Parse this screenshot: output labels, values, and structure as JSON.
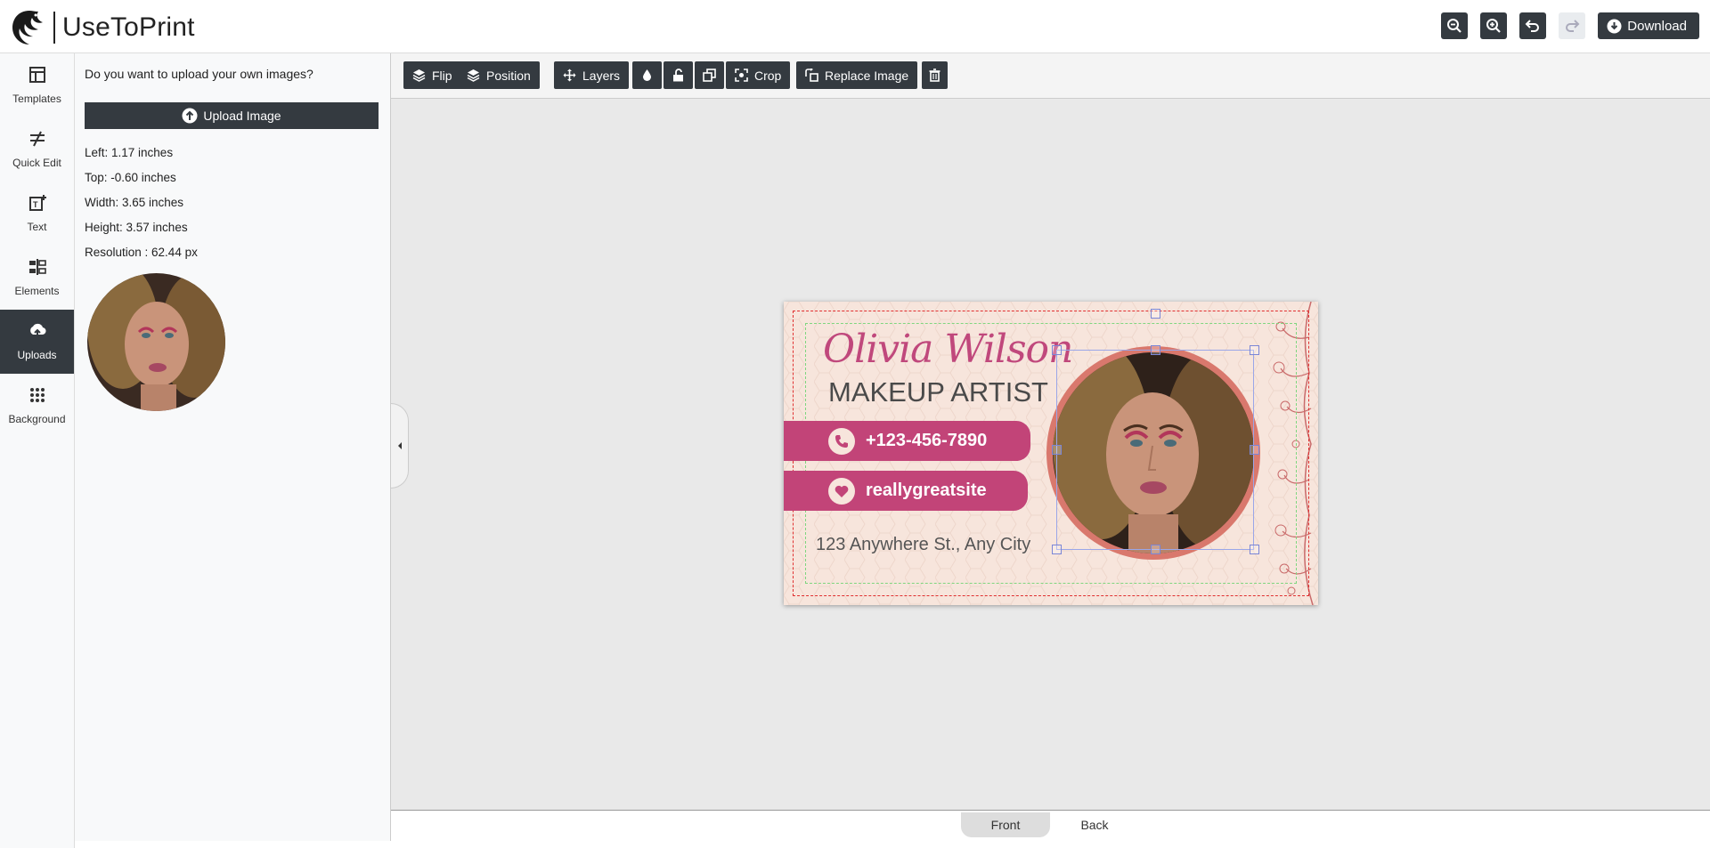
{
  "app": {
    "name": "UseToPrint"
  },
  "header": {
    "zoom_out_icon": "zoom-out-icon",
    "zoom_in_icon": "zoom-in-icon",
    "undo_icon": "undo-icon",
    "redo_icon": "redo-icon",
    "download_label": "Download"
  },
  "sidebar": {
    "items": [
      {
        "label": "Templates",
        "icon": "templates-icon"
      },
      {
        "label": "Quick Edit",
        "icon": "quick-edit-icon"
      },
      {
        "label": "Text",
        "icon": "text-icon"
      },
      {
        "label": "Elements",
        "icon": "elements-icon"
      },
      {
        "label": "Uploads",
        "icon": "upload-icon",
        "active": true
      },
      {
        "label": "Background",
        "icon": "background-grid-icon"
      }
    ]
  },
  "uploads_panel": {
    "question": "Do you want to upload your own images?",
    "upload_button": "Upload Image",
    "left": "Left: 1.17 inches",
    "top": "Top: -0.60 inches",
    "width": "Width: 3.65 inches",
    "height": "Height: 3.57 inches",
    "resolution": "Resolution : 62.44 px"
  },
  "toolbar": {
    "flip": "Flip",
    "position": "Position",
    "layers": "Layers",
    "crop": "Crop",
    "replace_image": "Replace Image"
  },
  "card": {
    "name": "Olivia Wilson",
    "title": "MAKEUP ARTIST",
    "phone": "+123-456-7890",
    "website": "reallygreatsite",
    "address": "123 Anywhere St., Any City"
  },
  "pages": {
    "front": "Front",
    "back": "Back"
  },
  "colors": {
    "dark_button": "#343a40",
    "card_background": "#f7e5dc",
    "accent_pink": "#c24478",
    "name_pink": "#c0487c",
    "photo_ring": "#d9786d"
  }
}
